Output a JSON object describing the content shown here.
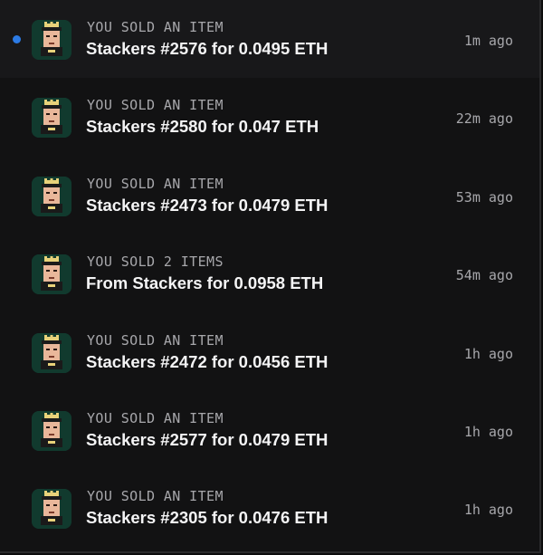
{
  "colors": {
    "background": "#121213",
    "unread_dot": "#2c7be5",
    "avatar_bg": "#113a2e",
    "muted_text": "#a7a7ab",
    "primary_text": "#f4f4f5"
  },
  "notifications": [
    {
      "kicker": "YOU SOLD AN ITEM",
      "title": "Stackers #2576 for 0.0495 ETH",
      "time": "1m ago",
      "unread": true,
      "icon": "stackers-avatar-icon"
    },
    {
      "kicker": "YOU SOLD AN ITEM",
      "title": "Stackers #2580 for 0.047 ETH",
      "time": "22m ago",
      "unread": false,
      "icon": "stackers-avatar-icon"
    },
    {
      "kicker": "YOU SOLD AN ITEM",
      "title": "Stackers #2473 for 0.0479 ETH",
      "time": "53m ago",
      "unread": false,
      "icon": "stackers-avatar-icon"
    },
    {
      "kicker": "YOU SOLD 2 ITEMS",
      "title": "From Stackers for 0.0958 ETH",
      "time": "54m ago",
      "unread": false,
      "icon": "stackers-avatar-icon"
    },
    {
      "kicker": "YOU SOLD AN ITEM",
      "title": "Stackers #2472 for 0.0456 ETH",
      "time": "1h ago",
      "unread": false,
      "icon": "stackers-avatar-icon"
    },
    {
      "kicker": "YOU SOLD AN ITEM",
      "title": "Stackers #2577 for 0.0479 ETH",
      "time": "1h ago",
      "unread": false,
      "icon": "stackers-avatar-icon"
    },
    {
      "kicker": "YOU SOLD AN ITEM",
      "title": "Stackers #2305 for 0.0476 ETH",
      "time": "1h ago",
      "unread": false,
      "icon": "stackers-avatar-icon"
    }
  ]
}
